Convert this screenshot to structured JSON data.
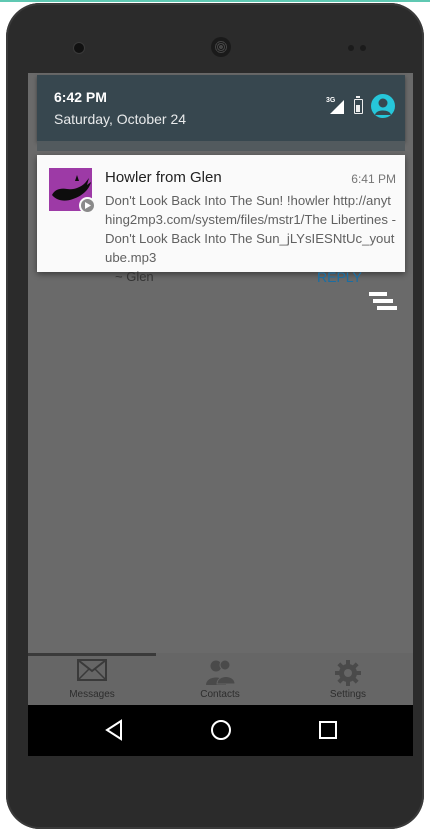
{
  "status_shade": {
    "time": "6:42 PM",
    "date": "Saturday, October 24",
    "network_label": "3G",
    "icons": [
      "signal-icon",
      "battery-icon",
      "account-icon"
    ]
  },
  "notification": {
    "title": "Howler from Glen",
    "time": "6:41 PM",
    "body": "Don't Look Back Into The Sun! !howler http://anything2mp3.com/system/files/mstr1/The Libertines - Don't Look Back Into The Sun_jLYsIESNtUc_youtube.mp3",
    "icon": "howler-whale-icon",
    "badge_icon": "play-badge-icon"
  },
  "message_area": {
    "signature": "~ Glen",
    "reply_label": "REPLY",
    "menu_icon": "stacked-menu-icon"
  },
  "tabs": [
    {
      "label": "Messages",
      "icon": "envelope-icon",
      "selected": true
    },
    {
      "label": "Contacts",
      "icon": "contacts-icon",
      "selected": false
    },
    {
      "label": "Settings",
      "icon": "gear-icon",
      "selected": false
    }
  ],
  "navigation": [
    "back-icon",
    "home-icon",
    "recents-icon"
  ],
  "colors": {
    "shade_bg": "#37474f",
    "avatar_accent": "#26c6da",
    "notif_icon_bg": "#9d3aa6",
    "reply_color": "#1a6ea3",
    "top_strip": "#5fc8b2"
  }
}
